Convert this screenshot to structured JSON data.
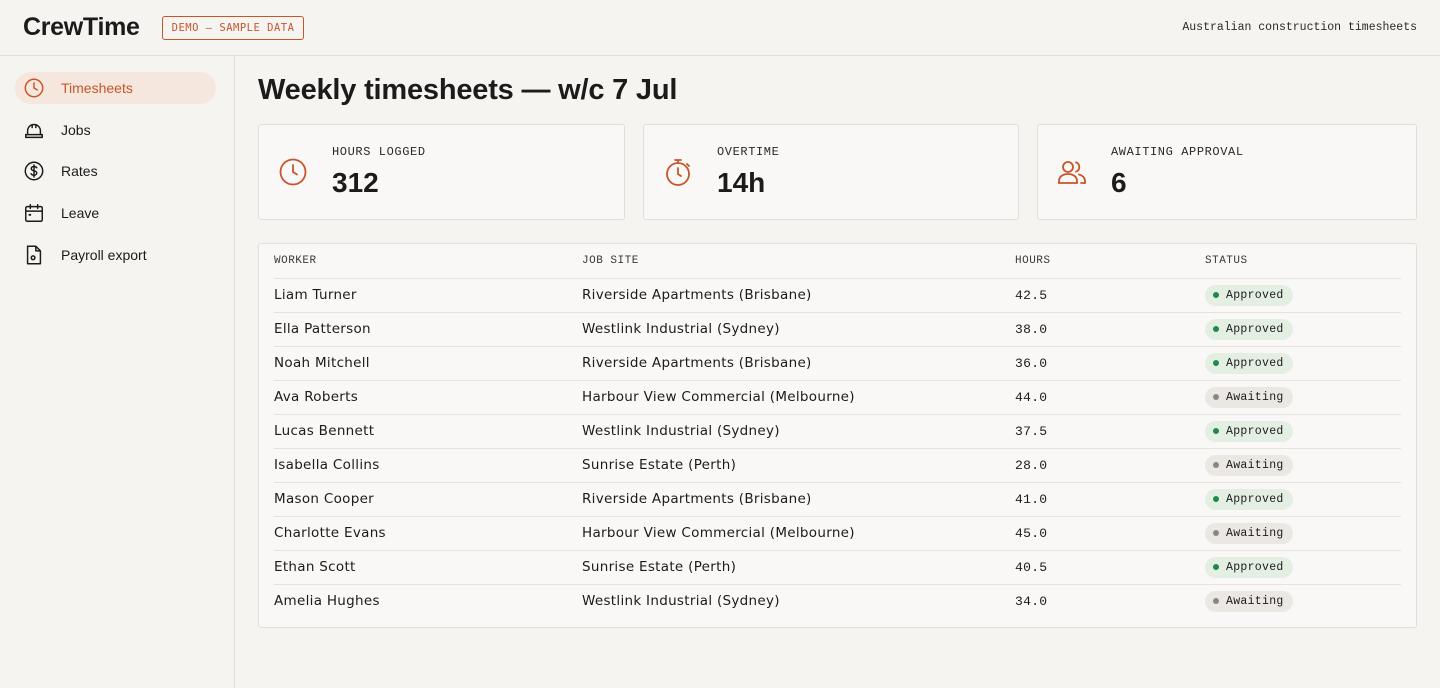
{
  "app": {
    "brand": "CrewTime",
    "demo_badge": "DEMO — SAMPLE DATA",
    "tagline": "Australian construction timesheets"
  },
  "sidebar": {
    "items": [
      {
        "label": "Timesheets",
        "icon": "clock-icon",
        "active": true
      },
      {
        "label": "Jobs",
        "icon": "hard-hat-icon",
        "active": false
      },
      {
        "label": "Rates",
        "icon": "dollar-icon",
        "active": false
      },
      {
        "label": "Leave",
        "icon": "calendar-icon",
        "active": false
      },
      {
        "label": "Payroll export",
        "icon": "document-icon",
        "active": false
      }
    ]
  },
  "main": {
    "title": "Weekly timesheets — w/c 7 Jul",
    "stats": [
      {
        "label": "HOURS LOGGED",
        "value": "312",
        "icon": "clock-icon"
      },
      {
        "label": "OVERTIME",
        "value": "14h",
        "icon": "stopwatch-icon"
      },
      {
        "label": "AWAITING APPROVAL",
        "value": "6",
        "icon": "users-icon"
      }
    ],
    "table": {
      "headers": {
        "worker": "WORKER",
        "site": "JOB SITE",
        "hours": "HOURS",
        "status": "STATUS"
      },
      "rows": [
        {
          "worker": "Liam Turner",
          "site": "Riverside Apartments (Brisbane)",
          "hours": "42.5",
          "status": "Approved"
        },
        {
          "worker": "Ella Patterson",
          "site": "Westlink Industrial (Sydney)",
          "hours": "38.0",
          "status": "Approved"
        },
        {
          "worker": "Noah Mitchell",
          "site": "Riverside Apartments (Brisbane)",
          "hours": "36.0",
          "status": "Approved"
        },
        {
          "worker": "Ava Roberts",
          "site": "Harbour View Commercial (Melbourne)",
          "hours": "44.0",
          "status": "Awaiting"
        },
        {
          "worker": "Lucas Bennett",
          "site": "Westlink Industrial (Sydney)",
          "hours": "37.5",
          "status": "Approved"
        },
        {
          "worker": "Isabella Collins",
          "site": "Sunrise Estate (Perth)",
          "hours": "28.0",
          "status": "Awaiting"
        },
        {
          "worker": "Mason Cooper",
          "site": "Riverside Apartments (Brisbane)",
          "hours": "41.0",
          "status": "Approved"
        },
        {
          "worker": "Charlotte Evans",
          "site": "Harbour View Commercial (Melbourne)",
          "hours": "45.0",
          "status": "Awaiting"
        },
        {
          "worker": "Ethan Scott",
          "site": "Sunrise Estate (Perth)",
          "hours": "40.5",
          "status": "Approved"
        },
        {
          "worker": "Amelia Hughes",
          "site": "Westlink Industrial (Sydney)",
          "hours": "34.0",
          "status": "Awaiting"
        }
      ]
    }
  },
  "colors": {
    "accent": "#c8552a",
    "approved": "#1f8a4c",
    "awaiting": "#8a8782",
    "background": "#f6f4f1"
  }
}
